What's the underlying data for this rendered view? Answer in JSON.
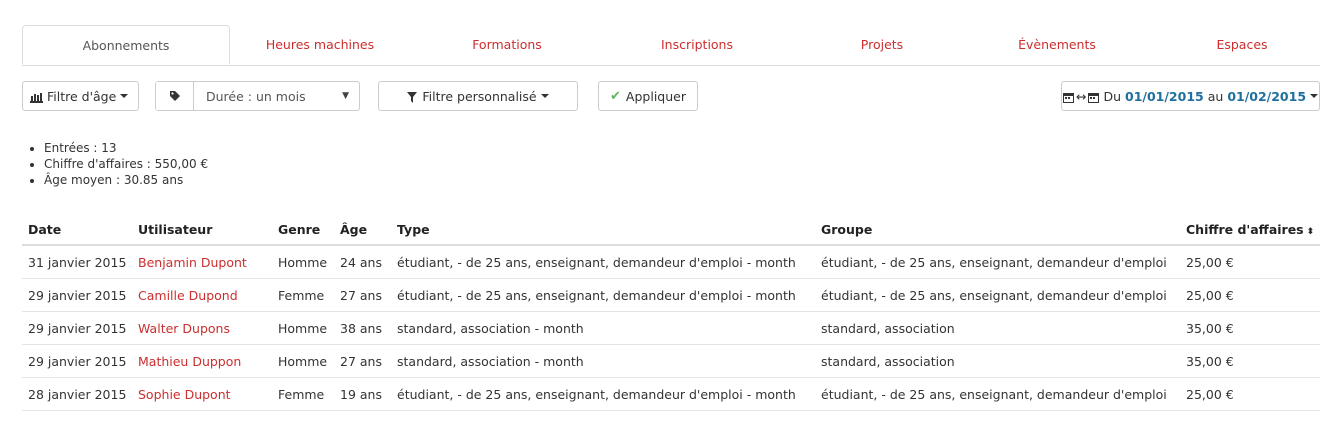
{
  "tabs": [
    {
      "label": "Abonnements",
      "active": true
    },
    {
      "label": "Heures machines",
      "active": false
    },
    {
      "label": "Formations",
      "active": false
    },
    {
      "label": "Inscriptions",
      "active": false
    },
    {
      "label": "Projets",
      "active": false
    },
    {
      "label": "Évènements",
      "active": false
    },
    {
      "label": "Espaces",
      "active": false
    }
  ],
  "toolbar": {
    "age_filter_label": "Filtre d'âge",
    "duration_value": "Durée : un mois",
    "custom_filter_label": "Filtre personnalisé",
    "apply_label": "Appliquer",
    "date_range": {
      "prefix": "Du",
      "start": "01/01/2015",
      "middle": "au",
      "end": "01/02/2015"
    }
  },
  "stats": {
    "entries": "Entrées : 13",
    "revenue": "Chiffre d'affaires : 550,00 €",
    "avg_age": "Âge moyen : 30.85 ans"
  },
  "table": {
    "headers": {
      "date": "Date",
      "user": "Utilisateur",
      "gender": "Genre",
      "age": "Âge",
      "type": "Type",
      "group": "Groupe",
      "revenue": "Chiffre d'affaires"
    },
    "rows": [
      {
        "date": "31 janvier 2015",
        "user": "Benjamin Dupont",
        "gender": "Homme",
        "age": "24 ans",
        "type": "étudiant, - de 25 ans, enseignant, demandeur d'emploi - month",
        "group": "étudiant, - de 25 ans, enseignant, demandeur d'emploi",
        "revenue": "25,00 €"
      },
      {
        "date": "29 janvier 2015",
        "user": "Camille Dupond",
        "gender": "Femme",
        "age": "27 ans",
        "type": "étudiant, - de 25 ans, enseignant, demandeur d'emploi - month",
        "group": "étudiant, - de 25 ans, enseignant, demandeur d'emploi",
        "revenue": "25,00 €"
      },
      {
        "date": "29 janvier 2015",
        "user": "Walter Dupons",
        "gender": "Homme",
        "age": "38 ans",
        "type": "standard, association - month",
        "group": "standard, association",
        "revenue": "35,00 €"
      },
      {
        "date": "29 janvier 2015",
        "user": "Mathieu Duppon",
        "gender": "Homme",
        "age": "27 ans",
        "type": "standard, association - month",
        "group": "standard, association",
        "revenue": "35,00 €"
      },
      {
        "date": "28 janvier 2015",
        "user": "Sophie Dupont",
        "gender": "Femme",
        "age": "19 ans",
        "type": "étudiant, - de 25 ans, enseignant, demandeur d'emploi - month",
        "group": "étudiant, - de 25 ans, enseignant, demandeur d'emploi",
        "revenue": "25,00 €"
      }
    ]
  },
  "colors": {
    "link_red": "#cc2e2e",
    "date_blue": "#1f6f9f",
    "check_green": "#5cb85c"
  }
}
